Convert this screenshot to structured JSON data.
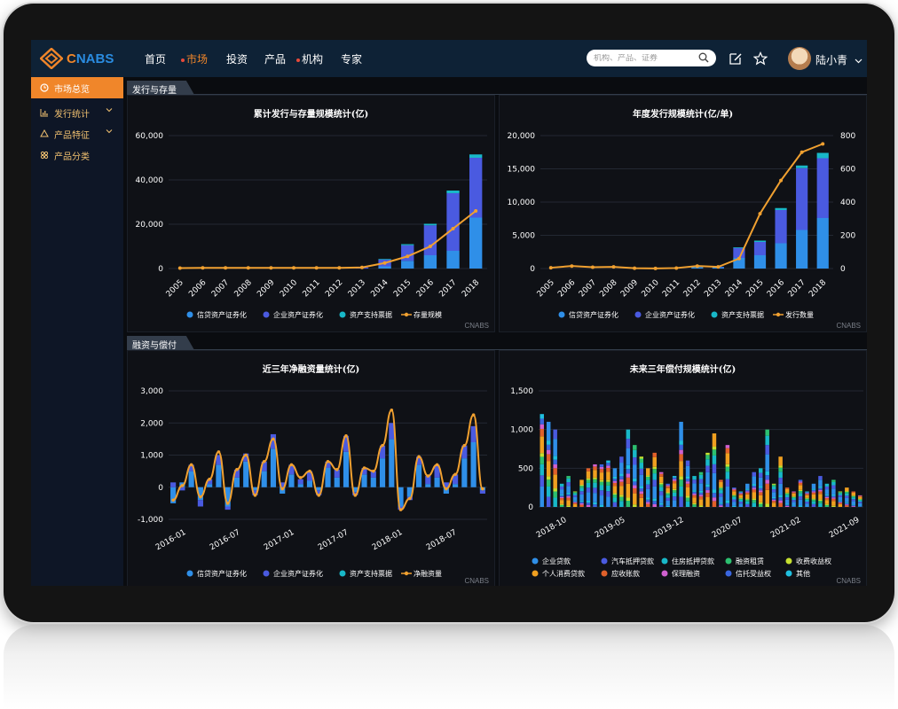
{
  "header": {
    "logo_text_a": "C",
    "logo_text_b": "NABS",
    "nav": [
      {
        "label": "首页",
        "active": false,
        "dot": false
      },
      {
        "label": "市场",
        "active": true,
        "dot": true
      },
      {
        "label": "投资",
        "active": false,
        "dot": false
      },
      {
        "label": "产品",
        "active": false,
        "dot": false
      },
      {
        "label": "机构",
        "active": false,
        "dot": true
      },
      {
        "label": "专家",
        "active": false,
        "dot": false
      }
    ],
    "search_placeholder": "机构、产品、证券",
    "user_name": "陆小青"
  },
  "sidebar": {
    "items": [
      {
        "label": "市场总览",
        "icon": "clock-icon",
        "active": true,
        "expandable": false
      },
      {
        "label": "发行统计",
        "icon": "bar-chart-icon",
        "active": false,
        "expandable": true
      },
      {
        "label": "产品特征",
        "icon": "recycle-icon",
        "active": false,
        "expandable": true
      },
      {
        "label": "产品分类",
        "icon": "grid-icon",
        "active": false,
        "expandable": false
      }
    ]
  },
  "sections": {
    "issuance": "发行与存量",
    "financing": "融资与偿付"
  },
  "colors": {
    "credit": "#2f8fe8",
    "corporate": "#4a5ae0",
    "abcp": "#18b8c8",
    "line": "#f0a030"
  },
  "charts": [
    {
      "id": "cumulative",
      "title": "累计发行与存量规模统计(亿)",
      "watermark": "CNABS",
      "chart_data": {
        "type": "bar",
        "stacked": true,
        "categories": [
          "2005",
          "2006",
          "2007",
          "2008",
          "2009",
          "2010",
          "2011",
          "2012",
          "2013",
          "2014",
          "2015",
          "2016",
          "2017",
          "2018"
        ],
        "ylim": [
          0,
          60000
        ],
        "yticks": [
          "0",
          "20,000",
          "40,000",
          "60,000"
        ],
        "series": [
          {
            "name": "信贷资产证券化",
            "values": [
              0,
              0,
              0,
              0,
              0,
              0,
              0,
              0,
              0,
              1000,
              3500,
              6000,
              8000,
              23000
            ]
          },
          {
            "name": "企业资产证券化",
            "values": [
              0,
              0,
              0,
              0,
              0,
              0,
              0,
              0,
              500,
              3000,
              7000,
              13500,
              26000,
              27000
            ]
          },
          {
            "name": "资产支持票据",
            "values": [
              0,
              0,
              0,
              0,
              0,
              0,
              0,
              0,
              0,
              300,
              500,
              700,
              1200,
              1500
            ]
          }
        ],
        "line": {
          "name": "存量规模",
          "values": [
            200,
            300,
            300,
            300,
            300,
            300,
            300,
            300,
            500,
            2500,
            5500,
            10000,
            18000,
            26000
          ]
        }
      }
    },
    {
      "id": "annual",
      "title": "年度发行规模统计(亿/单)",
      "watermark": "CNABS",
      "chart_data": {
        "type": "bar",
        "stacked": true,
        "categories": [
          "2005",
          "2006",
          "2007",
          "2008",
          "2009",
          "2010",
          "2011",
          "2012",
          "2013",
          "2014",
          "2015",
          "2016",
          "2017",
          "2018"
        ],
        "ylim": [
          0,
          20000
        ],
        "yticks": [
          "0",
          "5,000",
          "10,000",
          "15,000",
          "20,000"
        ],
        "y2lim": [
          0,
          800
        ],
        "y2ticks": [
          "0",
          "200",
          "400",
          "600",
          "800"
        ],
        "series": [
          {
            "name": "信贷资产证券化",
            "values": [
              0,
              0,
              0,
              0,
              0,
              0,
              0,
              200,
              200,
              1600,
              2000,
              3800,
              5800,
              7600
            ]
          },
          {
            "name": "企业资产证券化",
            "values": [
              0,
              0,
              0,
              0,
              0,
              0,
              0,
              0,
              50,
              1500,
              2000,
              5000,
              9300,
              9000
            ]
          },
          {
            "name": "资产支持票据",
            "values": [
              0,
              0,
              0,
              0,
              0,
              0,
              0,
              0,
              0,
              100,
              200,
              300,
              400,
              800
            ]
          }
        ],
        "line": {
          "name": "发行数量",
          "values": [
            5,
            15,
            8,
            10,
            2,
            1,
            3,
            15,
            10,
            60,
            330,
            530,
            700,
            750
          ]
        }
      }
    },
    {
      "id": "netfinancing",
      "title": "近三年净融资量统计(亿)",
      "watermark": "CNABS",
      "chart_data": {
        "type": "bar",
        "stacked": true,
        "xticks": [
          "2016-01",
          "2016-07",
          "2017-01",
          "2017-07",
          "2018-01",
          "2018-07"
        ],
        "ylim": [
          -1000,
          3000
        ],
        "yticks": [
          "-1,000",
          "0",
          "1,000",
          "2,000",
          "3,000"
        ],
        "series": [
          {
            "name": "信贷资产证券化",
            "values": [
              -500,
              150,
              500,
              -400,
              100,
              700,
              -600,
              300,
              800,
              -100,
              500,
              1200,
              -200,
              400,
              100,
              200,
              -100,
              600,
              300,
              1100,
              -150,
              400,
              300,
              900,
              1500,
              -600,
              -300,
              700,
              100,
              300,
              -200,
              100,
              900,
              1400,
              -100
            ]
          },
          {
            "name": "企业资产证券化",
            "values": [
              150,
              -100,
              200,
              -200,
              150,
              300,
              -100,
              250,
              250,
              -150,
              300,
              450,
              150,
              300,
              150,
              300,
              -150,
              200,
              250,
              500,
              -100,
              200,
              200,
              400,
              500,
              -100,
              -100,
              250,
              250,
              400,
              150,
              300,
              400,
              500,
              -100
            ]
          },
          {
            "name": "资产支持票据",
            "values": [
              0,
              0,
              0,
              0,
              0,
              0,
              0,
              0,
              0,
              0,
              0,
              0,
              0,
              0,
              0,
              0,
              0,
              0,
              0,
              0,
              0,
              0,
              0,
              0,
              0,
              0,
              0,
              0,
              0,
              0,
              0,
              0,
              0,
              0,
              0
            ]
          }
        ],
        "line": {
          "name": "净融资量",
          "values": [
            -400,
            50,
            700,
            -300,
            250,
            1100,
            -500,
            550,
            1000,
            -250,
            800,
            1500,
            -50,
            700,
            300,
            500,
            -250,
            800,
            550,
            1600,
            -250,
            600,
            500,
            1300,
            2400,
            -700,
            -350,
            950,
            350,
            700,
            -50,
            400,
            1300,
            2250,
            -50
          ]
        }
      }
    },
    {
      "id": "repayment",
      "title": "未来三年偿付规模统计(亿)",
      "watermark": "CNABS",
      "chart_data": {
        "type": "bar",
        "stacked": true,
        "xticks": [
          "2018-10",
          "2019-05",
          "2019-12",
          "2020-07",
          "2021-02",
          "2021-09"
        ],
        "ylim": [
          0,
          1500
        ],
        "yticks": [
          "0",
          "500",
          "1,000",
          "1,500"
        ],
        "totals": [
          1200,
          1100,
          1000,
          300,
          400,
          200,
          350,
          500,
          550,
          550,
          600,
          500,
          650,
          1000,
          800,
          650,
          500,
          700,
          450,
          300,
          400,
          1100,
          600,
          400,
          450,
          700,
          950,
          350,
          800,
          250,
          200,
          300,
          450,
          500,
          1000,
          300,
          650,
          250,
          200,
          350,
          200,
          300,
          400,
          300,
          350,
          200,
          250,
          200,
          150
        ],
        "series_names": [
          "企业贷款",
          "汽车抵押贷款",
          "住房抵押贷款",
          "融资租赁",
          "收费收益权",
          "个人消费贷款",
          "应收账款",
          "保理融资",
          "信托受益权",
          "其他"
        ],
        "series_colors": [
          "#2f8fe8",
          "#4a5ae0",
          "#18b8c8",
          "#2cc070",
          "#c6e030",
          "#f0a020",
          "#e0602a",
          "#d060d0",
          "#3a66e0",
          "#20c0e0"
        ]
      }
    }
  ]
}
